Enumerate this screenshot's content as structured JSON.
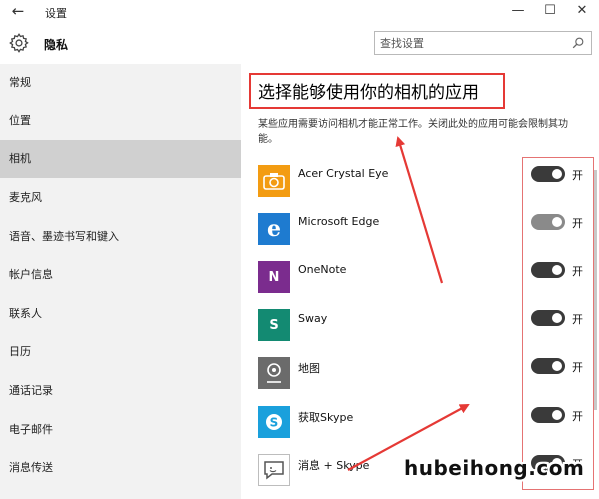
{
  "window": {
    "title": "设置",
    "back_glyph": "←",
    "minimize_glyph": "—",
    "maximize_glyph": "☐",
    "close_glyph": "✕"
  },
  "header": {
    "title": "隐私",
    "icon": "gear-icon"
  },
  "search": {
    "placeholder": "查找设置",
    "icon": "search-icon"
  },
  "sidebar": {
    "items": [
      {
        "label": "常规"
      },
      {
        "label": "位置"
      },
      {
        "label": "相机",
        "active": true
      },
      {
        "label": "麦克风"
      },
      {
        "label": "语音、墨迹书写和键入"
      },
      {
        "label": "帐户信息"
      },
      {
        "label": "联系人"
      },
      {
        "label": "日历"
      },
      {
        "label": "通话记录"
      },
      {
        "label": "电子邮件"
      },
      {
        "label": "消息传送"
      }
    ]
  },
  "main": {
    "section_title": "选择能够使用你的相机的应用",
    "description": "某些应用需要访问相机才能正常工作。关闭此处的应用可能会限制其功能。",
    "apps": [
      {
        "name": "Acer Crystal Eye",
        "icon": "camera-icon",
        "color": "#f39c12",
        "state": "开",
        "on": true
      },
      {
        "name": "Microsoft Edge",
        "icon": "edge-icon",
        "color": "#1e7bd0",
        "state": "开",
        "on": true
      },
      {
        "name": "OneNote",
        "icon": "onenote-icon",
        "color": "#7b2c8e",
        "state": "开",
        "on": true
      },
      {
        "name": "Sway",
        "icon": "sway-icon",
        "color": "#138a72",
        "state": "开",
        "on": true
      },
      {
        "name": "地图",
        "icon": "maps-icon",
        "color": "#6b6b6b",
        "state": "开",
        "on": true
      },
      {
        "name": "获取Skype",
        "icon": "skype-icon",
        "color": "#1aa0dc",
        "state": "开",
        "on": true
      },
      {
        "name": "消息 + Skype",
        "icon": "messaging-icon",
        "color": "#5a5a5a",
        "state": "开",
        "on": true
      }
    ]
  },
  "watermark": {
    "text": "hubeihong.com"
  },
  "colors": {
    "annotation_red": "#e53935",
    "sidebar_bg": "#f2f2f2",
    "sidebar_active": "#d0d0d0",
    "toggle_on": "#3a3a3a"
  }
}
